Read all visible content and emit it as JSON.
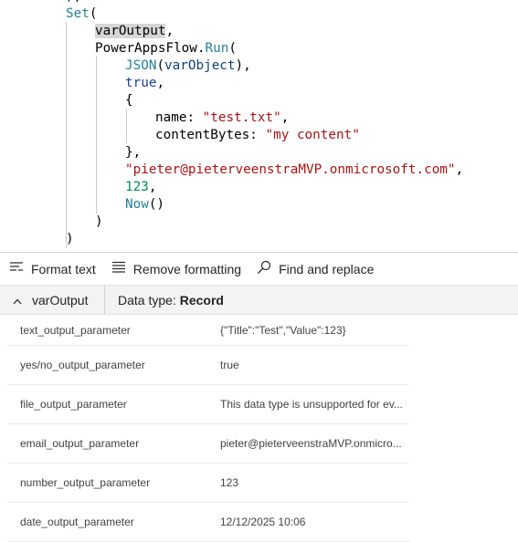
{
  "code": {
    "top_fragment": "),",
    "set_fn": "Set",
    "open_paren": "(",
    "var_output": "varOutput",
    "comma": ",",
    "run_call_obj": "PowerAppsFlow",
    "run_call_dot": ".",
    "run_call_method": "Run",
    "json_fn": "JSON",
    "json_arg": "varObject",
    "json_close": "),",
    "true_kw": "true",
    "open_brace": "{",
    "name_key": "name",
    "colon": ":",
    "name_value": "\"test.txt\"",
    "content_key": "contentBytes",
    "content_value": "\"my content\"",
    "close_brace": "},",
    "email_value": "\"pieter@pieterveenstraMVP.onmicrosoft.com\"",
    "number_value": "123",
    "now_fn": "Now",
    "now_parens": "()",
    "close_paren_inner": ")",
    "close_paren_outer": ")"
  },
  "toolbar": {
    "format_text": "Format text",
    "remove_formatting": "Remove formatting",
    "find_replace": "Find and replace"
  },
  "output": {
    "variable": "varOutput",
    "type_label": "Data type:",
    "type_value": "Record",
    "rows": [
      {
        "key": "text_output_parameter",
        "value": "{\"Title\":\"Test\",\"Value\":123}"
      },
      {
        "key": "yes/no_output_parameter",
        "value": "true"
      },
      {
        "key": "file_output_parameter",
        "value": "This data type is unsupported for ev..."
      },
      {
        "key": "email_output_parameter",
        "value": "pieter@pieterveenstraMVP.onmicro..."
      },
      {
        "key": "number_output_parameter",
        "value": "123"
      },
      {
        "key": "date_output_parameter",
        "value": "12/12/2025 10:06"
      }
    ]
  },
  "colors": {
    "function": "#267f99",
    "keyword": "#1a3fa0",
    "string": "#a31515",
    "number": "#098658",
    "header_bg": "#f3f3f3"
  },
  "icons": [
    "format-text-icon",
    "remove-formatting-icon",
    "search-icon",
    "chevron-up-icon"
  ]
}
